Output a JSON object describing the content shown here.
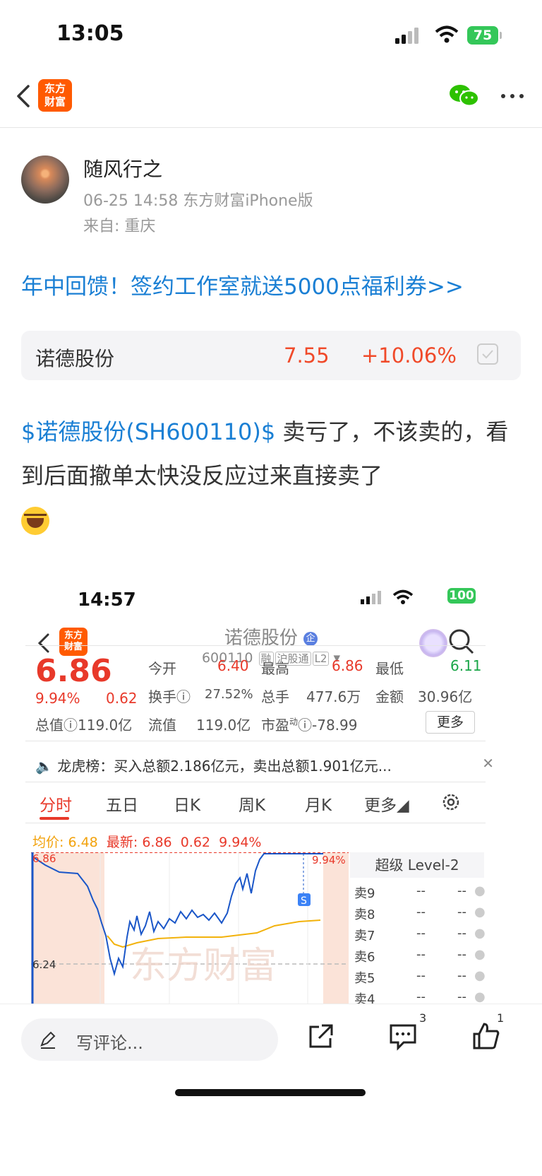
{
  "status_bar": {
    "time": "13:05",
    "battery": "75"
  },
  "nav": {
    "logo_text_1": "东方",
    "logo_text_2": "财富"
  },
  "post": {
    "author": "随风行之",
    "meta": "06-25 14:58 东方财富iPhone版",
    "location": "来自: 重庆",
    "promo_link": "年中回馈！签约工作室就送5000点福利券>>",
    "stock_card": {
      "name": "诺德股份",
      "price": "7.55",
      "change": "+10.06%"
    },
    "body_link": "$诺德股份(SH600110)$",
    "body_text_1": " 卖亏了，不该卖的，看到后面撤单太快没反应过来直接卖了"
  },
  "screenshot": {
    "status_time": "14:57",
    "battery": "100",
    "title": "诺德股份",
    "badge": "企",
    "code": "600110",
    "tags": [
      "融",
      "沪股通",
      "L2"
    ],
    "price": "6.86",
    "pct": "9.94%",
    "chg": "0.62",
    "quote": {
      "open_label": "今开",
      "open": "6.40",
      "high_label": "最高",
      "high": "6.86",
      "low_label": "最低",
      "low": "6.11",
      "turnover_label": "换手",
      "turnover": "27.52%",
      "volume_label": "总手",
      "volume": "477.6万",
      "amount_label": "金额",
      "amount": "30.96亿",
      "mktcap_label": "总值",
      "mktcap": "119.0亿",
      "float_label": "流值",
      "float": "119.0亿",
      "pe_label": "市盈",
      "pe_sup": "动",
      "pe": "-78.99",
      "more": "更多"
    },
    "lhb": "龙虎榜：买入总额2.186亿元，卖出总额1.901亿元...",
    "tabs": [
      "分时",
      "五日",
      "日K",
      "周K",
      "月K",
      "更多"
    ],
    "avg_label": "均价:",
    "avg": "6.48",
    "latest_label": "最新:",
    "latest": "6.86",
    "latest_chg": "0.62",
    "latest_pct": "9.94%",
    "chart_top": "6.86",
    "chart_mid": "6.24",
    "chart_pct": "9.94%",
    "watermark": "东方财富",
    "level2": "超级 Level-2",
    "sells": [
      "卖9",
      "卖8",
      "卖7",
      "卖6",
      "卖5",
      "卖4"
    ],
    "dash": "--"
  },
  "bottom": {
    "comment_placeholder": "写评论...",
    "comment_count": "3",
    "like_count": "1"
  }
}
